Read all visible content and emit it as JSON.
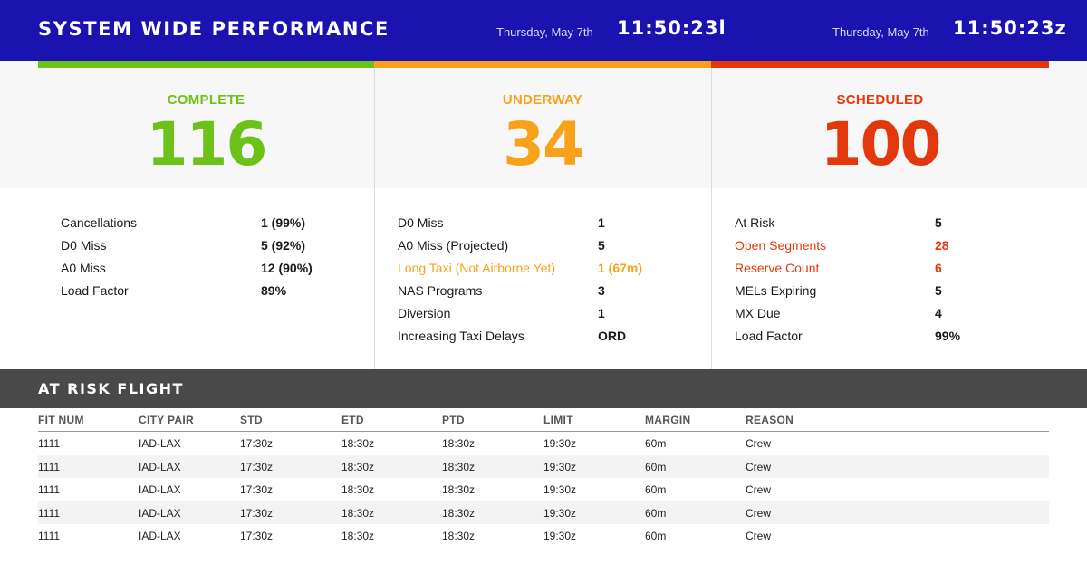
{
  "header": {
    "title": "SYSTEM WIDE PERFORMANCE",
    "local": {
      "date": "Thursday, May 7th",
      "time": "11:50:23l"
    },
    "zulu": {
      "date": "Thursday, May 7th",
      "time": "11:50:23z"
    }
  },
  "colors": {
    "header_bg": "#1b13b0",
    "complete": "#6cc218",
    "underway": "#f8a21b",
    "scheduled": "#e2380b",
    "risk_bar": "#494949"
  },
  "panels": [
    {
      "label": "COMPLETE",
      "count": "116",
      "metrics": [
        {
          "label": "Cancellations",
          "value": "1 (99%)"
        },
        {
          "label": "D0 Miss",
          "value": "5 (92%)"
        },
        {
          "label": "A0 Miss",
          "value": "12 (90%)"
        },
        {
          "label": "Load Factor",
          "value": "89%"
        }
      ]
    },
    {
      "label": "UNDERWAY",
      "count": "34",
      "metrics": [
        {
          "label": "D0 Miss",
          "value": "1"
        },
        {
          "label": "A0 Miss (Projected)",
          "value": "5"
        },
        {
          "label": "Long Taxi (Not Airborne Yet)",
          "value": "1 (67m)",
          "highlight": "#f8a21b"
        },
        {
          "label": "NAS Programs",
          "value": "3"
        },
        {
          "label": "Diversion",
          "value": "1"
        },
        {
          "label": "Increasing Taxi Delays",
          "value": "ORD"
        }
      ]
    },
    {
      "label": "SCHEDULED",
      "count": "100",
      "metrics": [
        {
          "label": "At Risk",
          "value": "5"
        },
        {
          "label": "Open Segments",
          "value": "28",
          "highlight": "#e2380b"
        },
        {
          "label": "Reserve Count",
          "value": "6",
          "highlight": "#e2380b"
        },
        {
          "label": "MELs Expiring",
          "value": "5"
        },
        {
          "label": "MX Due",
          "value": "4"
        },
        {
          "label": "Load Factor",
          "value": "99%"
        }
      ]
    }
  ],
  "at_risk": {
    "title": "AT RISK FLIGHT",
    "columns": [
      "FIT NUM",
      "CITY PAIR",
      "STD",
      "ETD",
      "PTD",
      "LIMIT",
      "MARGIN",
      "REASON"
    ],
    "rows": [
      [
        "1111",
        "IAD-LAX",
        "17:30z",
        "18:30z",
        "18:30z",
        "19:30z",
        "60m",
        "Crew"
      ],
      [
        "1111",
        "IAD-LAX",
        "17:30z",
        "18:30z",
        "18:30z",
        "19:30z",
        "60m",
        "Crew"
      ],
      [
        "1111",
        "IAD-LAX",
        "17:30z",
        "18:30z",
        "18:30z",
        "19:30z",
        "60m",
        "Crew"
      ],
      [
        "1111",
        "IAD-LAX",
        "17:30z",
        "18:30z",
        "18:30z",
        "19:30z",
        "60m",
        "Crew"
      ],
      [
        "1111",
        "IAD-LAX",
        "17:30z",
        "18:30z",
        "18:30z",
        "19:30z",
        "60m",
        "Crew"
      ]
    ]
  }
}
